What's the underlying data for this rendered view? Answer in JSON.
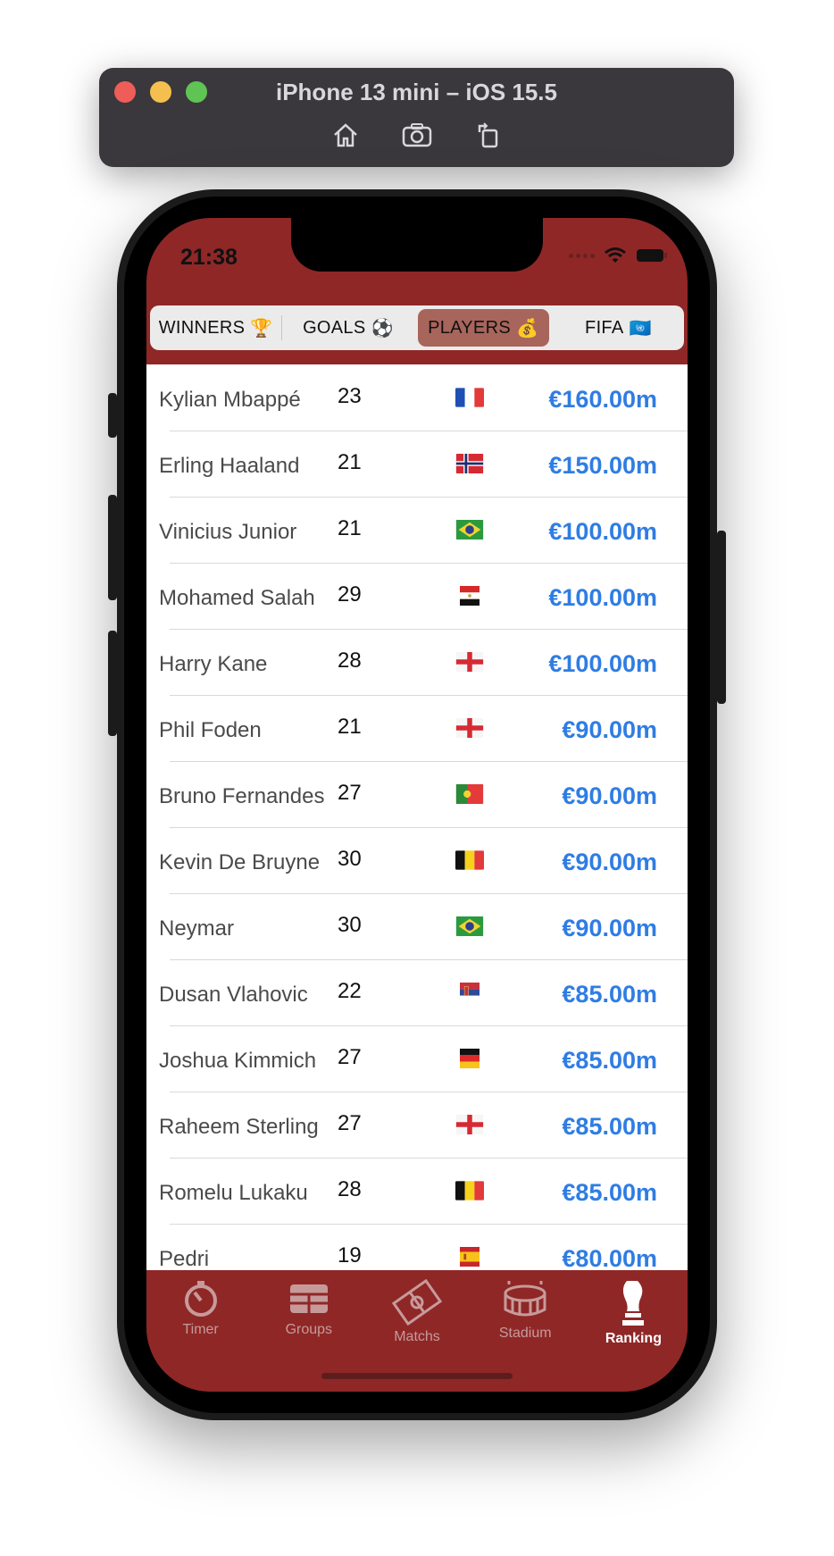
{
  "simulator": {
    "title": "iPhone 13 mini – iOS 15.5",
    "tools": [
      "home-icon",
      "screenshot-icon",
      "rotate-icon"
    ]
  },
  "status_bar": {
    "time": "21:38"
  },
  "segments": [
    {
      "label": "WINNERS",
      "emoji": "🏆",
      "selected": false
    },
    {
      "label": "GOALS",
      "emoji": "⚽",
      "selected": false
    },
    {
      "label": "PLAYERS",
      "emoji": "💰",
      "selected": true
    },
    {
      "label": "FIFA",
      "emoji": "🇺🇳",
      "selected": false
    }
  ],
  "players": [
    {
      "name": "Kylian Mbappé",
      "age": "23",
      "flag": "france",
      "value": "€160.00m"
    },
    {
      "name": "Erling Haaland",
      "age": "21",
      "flag": "norway",
      "value": "€150.00m"
    },
    {
      "name": "Vinicius Junior",
      "age": "21",
      "flag": "brazil",
      "value": "€100.00m"
    },
    {
      "name": "Mohamed Salah",
      "age": "29",
      "flag": "egypt",
      "value": "€100.00m"
    },
    {
      "name": "Harry Kane",
      "age": "28",
      "flag": "england",
      "value": "€100.00m"
    },
    {
      "name": "Phil Foden",
      "age": "21",
      "flag": "england",
      "value": "€90.00m"
    },
    {
      "name": "Bruno Fernandes",
      "age": "27",
      "flag": "portugal",
      "value": "€90.00m"
    },
    {
      "name": "Kevin De Bruyne",
      "age": "30",
      "flag": "belgium",
      "value": "€90.00m"
    },
    {
      "name": "Neymar",
      "age": "30",
      "flag": "brazil",
      "value": "€90.00m"
    },
    {
      "name": "Dusan Vlahovic",
      "age": "22",
      "flag": "serbia",
      "value": "€85.00m"
    },
    {
      "name": "Joshua Kimmich",
      "age": "27",
      "flag": "germany",
      "value": "€85.00m"
    },
    {
      "name": "Raheem Sterling",
      "age": "27",
      "flag": "england",
      "value": "€85.00m"
    },
    {
      "name": "Romelu Lukaku",
      "age": "28",
      "flag": "belgium",
      "value": "€85.00m"
    },
    {
      "name": "Pedri",
      "age": "19",
      "flag": "spain",
      "value": "€80.00m"
    }
  ],
  "tabs": [
    {
      "label": "Timer",
      "icon": "stopwatch-icon",
      "active": false
    },
    {
      "label": "Groups",
      "icon": "grid-icon",
      "active": false
    },
    {
      "label": "Matchs",
      "icon": "pitch-icon",
      "active": false
    },
    {
      "label": "Stadium",
      "icon": "stadium-icon",
      "active": false
    },
    {
      "label": "Ranking",
      "icon": "trophy-icon",
      "active": true
    }
  ],
  "colors": {
    "app_red": "#8f2727",
    "selected_segment": "#a8655b",
    "value_blue": "#2f7de3"
  }
}
